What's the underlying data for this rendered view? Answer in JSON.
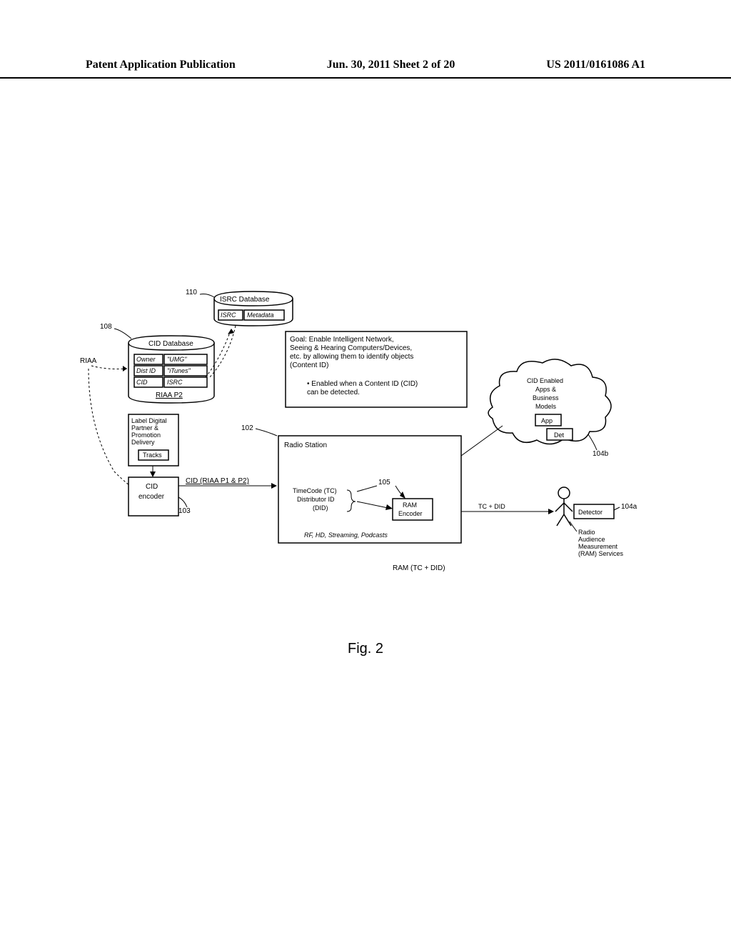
{
  "header": {
    "left": "Patent Application Publication",
    "center": "Jun. 30, 2011  Sheet 2 of 20",
    "right": "US 2011/0161086 A1"
  },
  "figure_label": "Fig. 2",
  "refs": {
    "r110": "110",
    "r108": "108",
    "r102": "102",
    "r103": "103",
    "r105": "105",
    "r104a": "104a",
    "r104b": "104b"
  },
  "isrc_db": {
    "title": "ISRC Database",
    "col1": "ISRC",
    "col2": "Metadata"
  },
  "cid_db": {
    "title": "CID Database",
    "row1_a": "Owner",
    "row1_b": "\"UMG\"",
    "row2_a": "Dist ID",
    "row2_b": "\"iTunes\"",
    "row3_a": "CID",
    "row3_b": "ISRC",
    "footer": "RIAA P2"
  },
  "riaa_label": "RIAA",
  "label_box": {
    "line1": "Label Digital",
    "line2": "Partner &",
    "line3": "Promotion",
    "line4": "Delivery",
    "tracks": "Tracks"
  },
  "cid_encoder": {
    "line1": "CID",
    "line2": "encoder"
  },
  "cid_arrow_label": "CID (RIAA P1 & P2)",
  "radio_station": {
    "title": "Radio Station",
    "tc": "TimeCode (TC)",
    "did_line1": "Distributor ID",
    "did_line2": "(DID)",
    "ram_enc1": "RAM",
    "ram_enc2": "Encoder",
    "footer": "RF, HD, Streaming, Podcasts"
  },
  "tc_did_label": "TC + DID",
  "ram_bottom": "RAM (TC + DID)",
  "goal_box": {
    "line1": "Goal: Enable Intelligent Network,",
    "line2": "Seeing & Hearing Computers/Devices,",
    "line3": "etc. by allowing them to identify objects",
    "line4": "(Content ID)",
    "bullet1a": "• Enabled when a Content ID (CID)",
    "bullet1b": "  can be detected."
  },
  "cloud": {
    "line1": "CID Enabled",
    "line2": "Apps &",
    "line3": "Business",
    "line4": "Models",
    "app": "App",
    "det": "Det"
  },
  "detector": {
    "label": "Detector",
    "line1": "Radio",
    "line2": "Audience",
    "line3": "Measurement",
    "line4": "(RAM) Services"
  }
}
